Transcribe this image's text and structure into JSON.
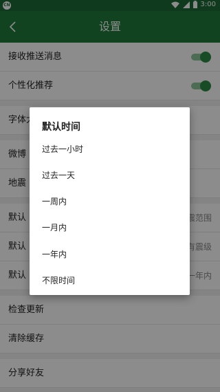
{
  "status_bar": {
    "left_icon": "CN",
    "time": "3:00",
    "icons": [
      "wifi-icon",
      "signal-icon",
      "battery-icon"
    ]
  },
  "app_bar": {
    "back_icon": "chevron-left-icon",
    "title": "设置"
  },
  "settings": {
    "push": {
      "label": "接收推送消息",
      "enabled": true
    },
    "personalized": {
      "label": "个性化推荐",
      "enabled": true
    },
    "font_size": {
      "label": "字体大"
    },
    "weibo": {
      "label": "微博"
    },
    "earthquake": {
      "label": "地震"
    },
    "default_range": {
      "label": "默认",
      "value": "震范围"
    },
    "default_magnitude": {
      "label": "默认",
      "value": "有震级"
    },
    "default_time": {
      "label": "默认",
      "value": "一年内"
    },
    "check_update": {
      "label": "检查更新"
    },
    "clear_cache": {
      "label": "清除缓存"
    },
    "share": {
      "label": "分享好友"
    }
  },
  "dialog": {
    "title": "默认时间",
    "options": [
      "过去一小时",
      "过去一天",
      "一周内",
      "一月内",
      "一年内",
      "不限时间"
    ]
  },
  "colors": {
    "app_bar": "#207a3c",
    "status_bar": "#1e6b35",
    "toggle_on": "#2b8a46"
  }
}
